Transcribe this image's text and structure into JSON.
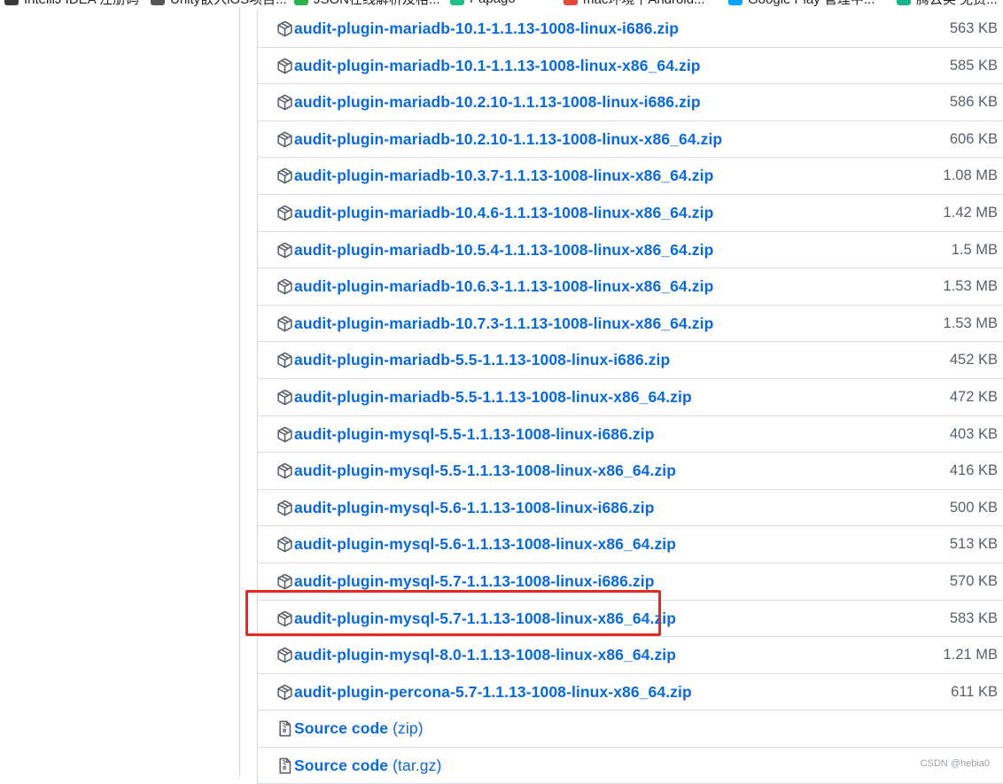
{
  "bookmarks": [
    {
      "label": "IntelliJ IDEA 注册码",
      "color": "#3a3a3a"
    },
    {
      "label": "Unity嵌入iOS项目...",
      "color": "#555555"
    },
    {
      "label": "JSON在线解析及格...",
      "color": "#2bb24c"
    },
    {
      "label": "Papago",
      "color": "#1ec08b"
    },
    {
      "label": "mac环境下Android...",
      "color": "#e34a3a"
    },
    {
      "label": "Google Play 管理中...",
      "color": "#00a3ff"
    },
    {
      "label": "腾云奖 免费...",
      "color": "#19b58a"
    }
  ],
  "assets": [
    {
      "name": "audit-plugin-mariadb-10.1-1.1.13-1008-linux-i686.zip",
      "size": "563 KB"
    },
    {
      "name": "audit-plugin-mariadb-10.1-1.1.13-1008-linux-x86_64.zip",
      "size": "585 KB"
    },
    {
      "name": "audit-plugin-mariadb-10.2.10-1.1.13-1008-linux-i686.zip",
      "size": "586 KB"
    },
    {
      "name": "audit-plugin-mariadb-10.2.10-1.1.13-1008-linux-x86_64.zip",
      "size": "606 KB"
    },
    {
      "name": "audit-plugin-mariadb-10.3.7-1.1.13-1008-linux-x86_64.zip",
      "size": "1.08 MB"
    },
    {
      "name": "audit-plugin-mariadb-10.4.6-1.1.13-1008-linux-x86_64.zip",
      "size": "1.42 MB"
    },
    {
      "name": "audit-plugin-mariadb-10.5.4-1.1.13-1008-linux-x86_64.zip",
      "size": "1.5 MB"
    },
    {
      "name": "audit-plugin-mariadb-10.6.3-1.1.13-1008-linux-x86_64.zip",
      "size": "1.53 MB"
    },
    {
      "name": "audit-plugin-mariadb-10.7.3-1.1.13-1008-linux-x86_64.zip",
      "size": "1.53 MB"
    },
    {
      "name": "audit-plugin-mariadb-5.5-1.1.13-1008-linux-i686.zip",
      "size": "452 KB"
    },
    {
      "name": "audit-plugin-mariadb-5.5-1.1.13-1008-linux-x86_64.zip",
      "size": "472 KB"
    },
    {
      "name": "audit-plugin-mysql-5.5-1.1.13-1008-linux-i686.zip",
      "size": "403 KB"
    },
    {
      "name": "audit-plugin-mysql-5.5-1.1.13-1008-linux-x86_64.zip",
      "size": "416 KB"
    },
    {
      "name": "audit-plugin-mysql-5.6-1.1.13-1008-linux-i686.zip",
      "size": "500 KB"
    },
    {
      "name": "audit-plugin-mysql-5.6-1.1.13-1008-linux-x86_64.zip",
      "size": "513 KB"
    },
    {
      "name": "audit-plugin-mysql-5.7-1.1.13-1008-linux-i686.zip",
      "size": "570 KB"
    },
    {
      "name": "audit-plugin-mysql-5.7-1.1.13-1008-linux-x86_64.zip",
      "size": "583 KB"
    },
    {
      "name": "audit-plugin-mysql-8.0-1.1.13-1008-linux-x86_64.zip",
      "size": "1.21 MB"
    },
    {
      "name": "audit-plugin-percona-5.7-1.1.13-1008-linux-x86_64.zip",
      "size": "611 KB"
    }
  ],
  "source_code": [
    {
      "label": "Source code",
      "ext": "(zip)"
    },
    {
      "label": "Source code",
      "ext": "(tar.gz)"
    }
  ],
  "icons": {
    "asset": "package-icon",
    "source": "file-zip-icon"
  },
  "colors": {
    "link": "#0969da",
    "size": "#57606a",
    "highlight": "#e8281e"
  },
  "watermark": "CSDN @hebia0"
}
